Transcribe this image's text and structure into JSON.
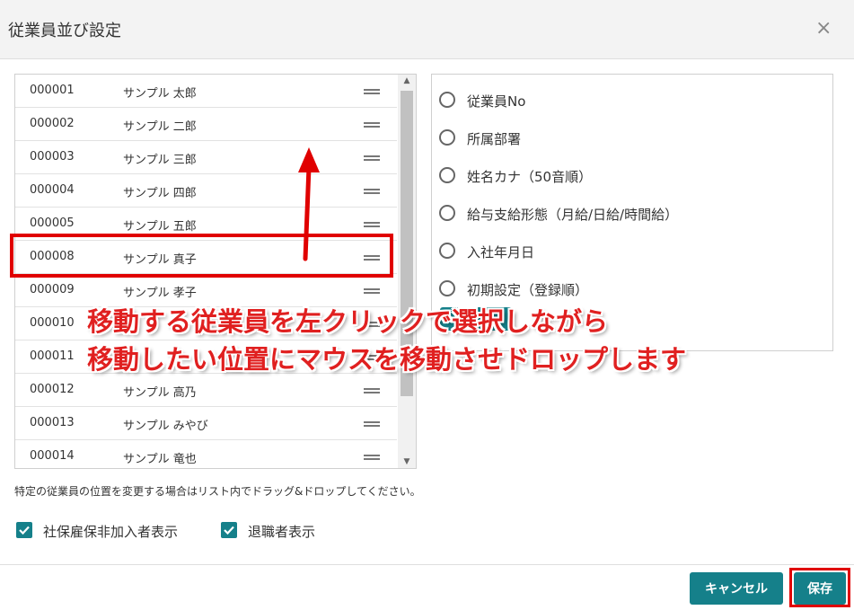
{
  "dialog": {
    "title": "従業員並び設定",
    "close_icon": "×"
  },
  "employees": [
    {
      "id": "000001",
      "name": "サンプル 太郎"
    },
    {
      "id": "000002",
      "name": "サンプル 二郎"
    },
    {
      "id": "000003",
      "name": "サンプル 三郎"
    },
    {
      "id": "000004",
      "name": "サンプル 四郎"
    },
    {
      "id": "000005",
      "name": "サンプル 五郎"
    },
    {
      "id": "000008",
      "name": "サンプル 真子"
    },
    {
      "id": "000009",
      "name": "サンプル 孝子"
    },
    {
      "id": "000010",
      "name": ""
    },
    {
      "id": "000011",
      "name": ""
    },
    {
      "id": "000012",
      "name": "サンプル 高乃"
    },
    {
      "id": "000013",
      "name": "サンプル みやび"
    },
    {
      "id": "000014",
      "name": "サンプル 竜也"
    }
  ],
  "sort_options": [
    {
      "label": "従業員No"
    },
    {
      "label": "所属部署"
    },
    {
      "label": "姓名カナ（50音順）"
    },
    {
      "label": "給与支給形態（月給/日給/時間給）"
    },
    {
      "label": "入社年月日"
    },
    {
      "label": "初期設定（登録順）"
    }
  ],
  "annotation": {
    "line1": "移動する従業員を左クリックで選択しながら",
    "line2": "移動したい位置にマウスを移動させドロップします",
    "color": "#e02020"
  },
  "help_text": "特定の従業員の位置を変更する場合はリスト内でドラッグ&ドロップしてください。",
  "checkboxes": [
    {
      "label": "社保雇保非加入者表示",
      "checked": true
    },
    {
      "label": "退職者表示",
      "checked": true
    }
  ],
  "footer": {
    "cancel_label": "キャンセル",
    "save_label": "保存"
  },
  "colors": {
    "accent": "#15808a",
    "highlight": "#e00000"
  }
}
